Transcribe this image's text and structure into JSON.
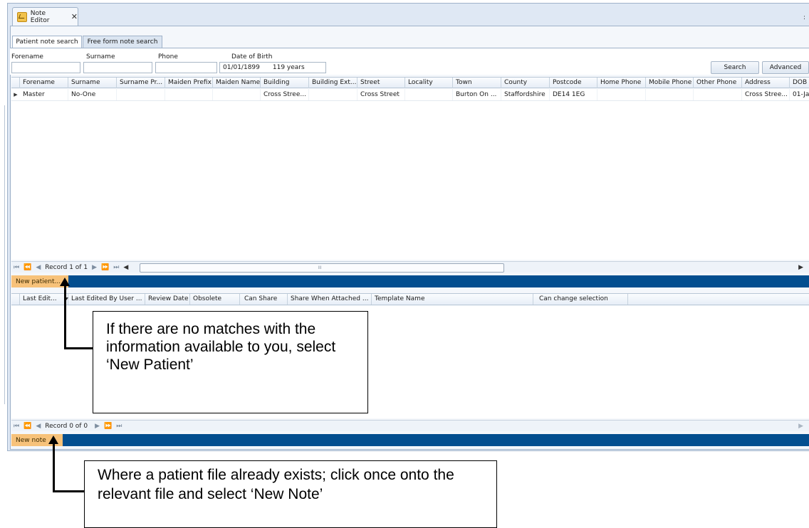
{
  "window": {
    "tab_title": "Note Editor",
    "close_glyph": "✕",
    "icon": "note-icon"
  },
  "search_tabs": [
    {
      "label": "Patient note search"
    },
    {
      "label": "Free form note search"
    }
  ],
  "search_form": {
    "forename_label": "Forename",
    "surname_label": "Surname",
    "phone_label": "Phone",
    "dob_label": "Date of Birth",
    "dob_value": "01/01/1899",
    "dob_years": "119 years",
    "forename_value": "",
    "surname_value": "",
    "phone_value": "",
    "search_button": "Search",
    "advanced_button": "Advanced"
  },
  "patient_grid": {
    "columns": [
      "Forename",
      "Surname",
      "Surname Pr...",
      "Maiden Prefix",
      "Maiden Name",
      "Building",
      "Building Ext...",
      "Street",
      "Locality",
      "Town",
      "County",
      "Postcode",
      "Home Phone",
      "Mobile Phone",
      "Other Phone",
      "Address",
      "DOB"
    ],
    "rows": [
      {
        "indicator": "▶",
        "cells": [
          "Master",
          "No-One",
          "",
          "",
          "",
          "Cross Stree...",
          "",
          "Cross Street",
          "",
          "Burton On ...",
          "Staffordshire",
          "DE14 1EG",
          "",
          "",
          "",
          "Cross Stree...",
          "01-Ja"
        ]
      }
    ],
    "nav": {
      "first": "⏮",
      "prev_page": "⏪",
      "prev": "◀",
      "record_text": "Record 1 of 1",
      "next": "▶",
      "next_page": "⏩",
      "last": "⏭",
      "scroll_left": "◀",
      "scroll_mid": "III",
      "scroll_right": "▶"
    },
    "new_patient_button": "New patient..."
  },
  "notes_grid": {
    "columns": [
      "Last Edit...",
      "Last Edited By User ...",
      "Review Date",
      "Obsolete",
      "Can Share",
      "Share When Attached ...",
      "Template Name",
      "Can change selection"
    ],
    "nav": {
      "first": "⏮",
      "prev_page": "⏪",
      "prev": "◀",
      "record_text": "Record 0 of 0",
      "next": "▶",
      "next_page": "⏩",
      "last": "⏭",
      "scroll_right": "▶"
    },
    "new_note_button": "New note"
  },
  "callouts": {
    "new_patient": "If there are no matches with the information available to you, select ‘New Patient’",
    "new_note": "Where a patient file already exists; click once onto the relevant file and select ‘New Note’"
  }
}
